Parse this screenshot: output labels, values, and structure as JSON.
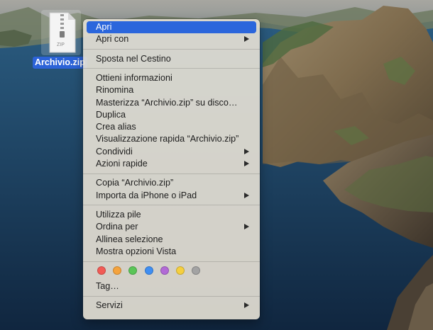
{
  "file": {
    "name": "Archivio.zip",
    "badge": "ZIP"
  },
  "menu": {
    "sections": [
      [
        {
          "label": "Apri",
          "active": true
        },
        {
          "label": "Apri con",
          "submenu": true
        }
      ],
      [
        {
          "label": "Sposta nel Cestino"
        }
      ],
      [
        {
          "label": "Ottieni informazioni"
        },
        {
          "label": "Rinomina"
        },
        {
          "label": "Masterizza “Archivio.zip” su disco…"
        },
        {
          "label": "Duplica"
        },
        {
          "label": "Crea alias"
        },
        {
          "label": "Visualizzazione rapida “Archivio.zip”"
        },
        {
          "label": "Condividi",
          "submenu": true
        },
        {
          "label": "Azioni rapide",
          "submenu": true
        }
      ],
      [
        {
          "label": "Copia “Archivio.zip”"
        },
        {
          "label": "Importa da iPhone o iPad",
          "submenu": true
        }
      ],
      [
        {
          "label": "Utilizza pile"
        },
        {
          "label": "Ordina per",
          "submenu": true
        },
        {
          "label": "Allinea selezione"
        },
        {
          "label": "Mostra opzioni Vista"
        }
      ],
      [
        {
          "label": "Tag…"
        }
      ],
      [
        {
          "label": "Servizi",
          "submenu": true
        }
      ]
    ],
    "tag_colors": [
      {
        "name": "red",
        "color": "#f25b55"
      },
      {
        "name": "orange",
        "color": "#f5a33d"
      },
      {
        "name": "green",
        "color": "#5ac557"
      },
      {
        "name": "blue",
        "color": "#3f8ef2"
      },
      {
        "name": "purple",
        "color": "#b26ad6"
      },
      {
        "name": "yellow",
        "color": "#f5cf3f"
      },
      {
        "name": "gray",
        "color": "#a3a3a3"
      }
    ]
  },
  "colors": {
    "highlight": "#2b66dc",
    "selection_label": "#2c63d8"
  }
}
